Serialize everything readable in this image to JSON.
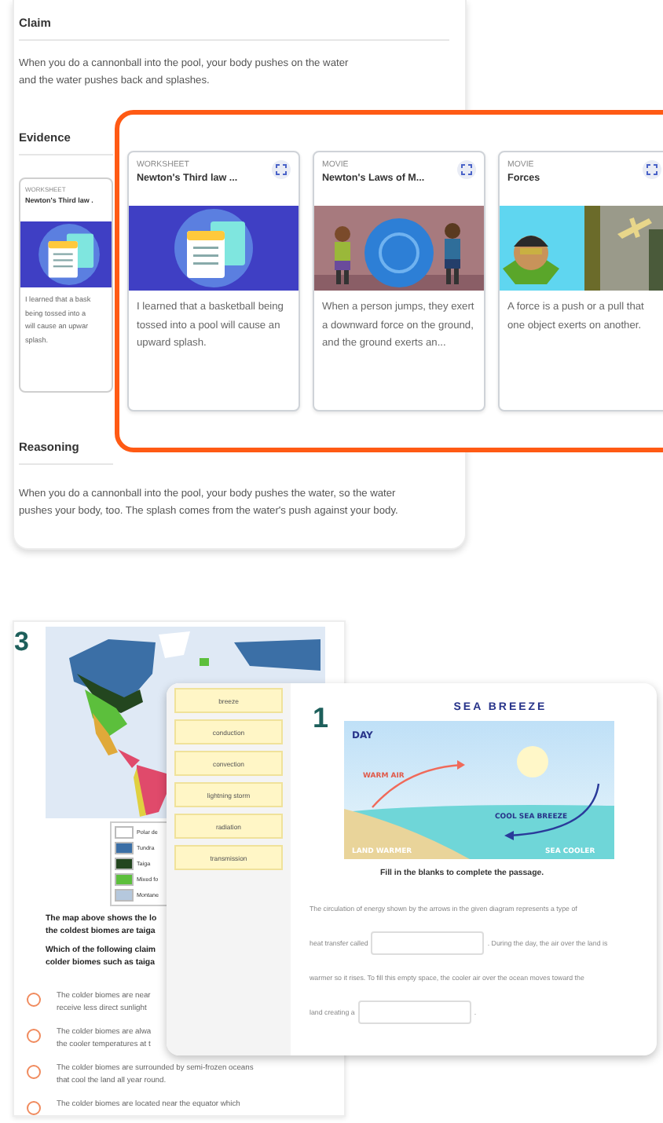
{
  "claim": {
    "heading": "Claim",
    "text": "When you do a cannonball into the pool, your body pushes on the water and the water pushes back and splashes."
  },
  "evidence": {
    "heading": "Evidence",
    "partial_card": {
      "kind": "worksheet",
      "type_label": "WORKSHEET",
      "title": "Newton's Third law .",
      "lines": [
        "I learned that a bask",
        "being tossed into a",
        "will cause an upwar",
        "splash."
      ]
    },
    "cards": [
      {
        "kind": "worksheet",
        "type_label": "WORKSHEET",
        "title": "Newton's Third law ...",
        "text": "I learned that a basketball being tossed into a pool will cause an upward splash."
      },
      {
        "kind": "movie",
        "type_label": "MOVIE",
        "title": "Newton's Laws of M...",
        "text": "When a person jumps, they exert a downward force on the ground, and the ground exerts an..."
      },
      {
        "kind": "movie",
        "type_label": "MOVIE",
        "title": "Forces",
        "text": "A force is a push or a pull that one object exerts on another."
      }
    ]
  },
  "reasoning": {
    "heading": "Reasoning",
    "text": "When you do a cannonball into the pool, your body pushes the water, so the water pushes your body, too. The splash comes from the water's push against your body."
  },
  "quiz": {
    "number": "3",
    "legend": [
      {
        "label": "Polar de",
        "color": "#ffffff"
      },
      {
        "label": "Tundra",
        "color": "#3b6fa6"
      },
      {
        "label": "Taiga",
        "color": "#23461f"
      },
      {
        "label": "Mixed fo",
        "color": "#5cbf3c"
      },
      {
        "label": "Montane",
        "color": "#b5c8dd"
      }
    ],
    "prompt_lines": [
      "The map above shows the lo",
      "the coldest biomes are taiga"
    ],
    "question_lines": [
      "Which of the following claim",
      "colder biomes such as taiga"
    ],
    "options": [
      {
        "lines": [
          "The colder biomes are near",
          "receive less direct sunlight"
        ],
        "selected": false
      },
      {
        "lines": [
          "The colder biomes are alwa",
          "the cooler temperatures at t"
        ],
        "selected": false
      },
      {
        "lines": [
          "The colder biomes are surrounded by semi-frozen oceans",
          "that cool the land all year round."
        ],
        "selected": false
      },
      {
        "lines": [
          "The colder biomes are located near the equator which"
        ],
        "selected": false
      }
    ]
  },
  "word_bank": [
    "breeze",
    "conduction",
    "convection",
    "lightning storm",
    "radiation",
    "transmission"
  ],
  "passage": {
    "number": "1",
    "diagram_title": "SEA BREEZE",
    "diagram_labels": {
      "day": "DAY",
      "warm": "WARM AIR",
      "cool": "COOL SEA BREEZE",
      "land": "LAND WARMER",
      "sea": "SEA COOLER"
    },
    "instruction": "Fill in the blanks to complete the passage.",
    "rows": [
      {
        "segments": [
          {
            "kind": "text",
            "text": "The circulation of energy shown by the arrows in the given diagram represents a type of"
          }
        ]
      },
      {
        "segments": [
          {
            "kind": "text",
            "text": "heat transfer called"
          },
          {
            "kind": "blank"
          },
          {
            "kind": "text",
            "text": ". During the day, the air over the land is"
          }
        ]
      },
      {
        "segments": [
          {
            "kind": "text",
            "text": "warmer so it rises. To fill this empty space, the cooler air over the ocean moves toward the"
          }
        ]
      },
      {
        "segments": [
          {
            "kind": "text",
            "text": "land creating a"
          },
          {
            "kind": "blank"
          },
          {
            "kind": "text",
            "text": "."
          }
        ]
      }
    ]
  }
}
